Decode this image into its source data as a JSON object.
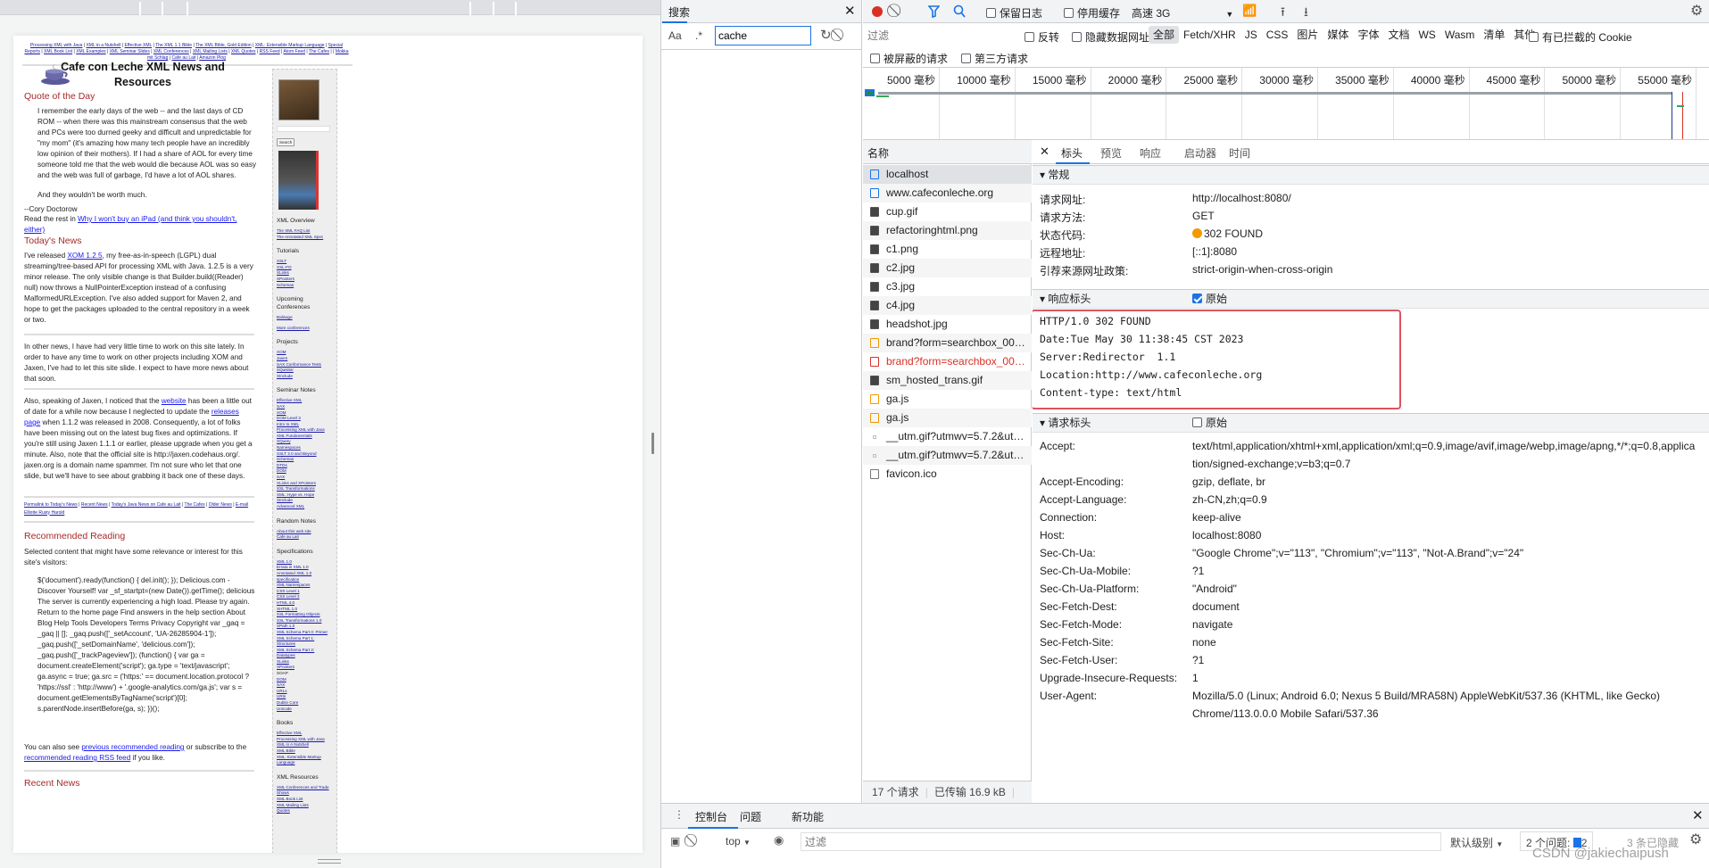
{
  "page": {
    "top_nav": [
      "Processing XML with Java",
      "XML in a Nutshell",
      "Effective XML",
      "The XML 1.1 Bible",
      "The XML Bible, Gold Edition",
      "XML: Extensible Markup Language",
      "Special Reports",
      "XML Book List",
      "XML Examples",
      "XML Seminar Slides",
      "XML Conferences",
      "XML Mailing Lists",
      "XML Quotes",
      "RSS Feed",
      "Atom Feed",
      "The Cafes",
      "",
      "Mokka mit Schlag",
      "Cafe au Lait",
      "Amazon Plog"
    ],
    "title": "Cafe con Leche XML News and Resources",
    "quote_heading": "Quote of the Day",
    "quote": "I remember the early days of the web -- and the last days of CD ROM -- when there was this mainstream consensus that the web and PCs were too durned geeky and difficult and unpredictable for \"my mom\" (it's amazing how many tech people have an incredibly low opinion of their mothers). If I had a share of AOL for every time someone told me that the web would die because AOL was so easy and the web was full of garbage, I'd have a lot of AOL shares.",
    "quote_end": "And they wouldn't be worth much.",
    "quote_author": "--Cory Doctorow",
    "read_rest_prefix": "Read the rest in ",
    "read_rest_link": "Why I won't buy an iPad (and think you shouldn't, either)",
    "news_heading": "Today's News",
    "news1_prefix": "I've released ",
    "news1_link": "XOM 1.2.5",
    "news1_rest": ", my free-as-in-speech (LGPL) dual streaming/tree-based API for processing XML with Java. 1.2.5 is a very minor release. The only visible change is that Builder.build((Reader) null) now throws a NullPointerException instead of a confusing MalformedURLException. I've also added support for Maven 2, and hope to get the packages uploaded to the central repository in a week or two.",
    "news2": "In other news, I have had very little time to work on this site lately. In order to have any time to work on other projects including XOM and Jaxen, I've had to let this site slide. I expect to have more news about that soon.",
    "news3_a": "Also, speaking of Jaxen, I noticed that the ",
    "news3_link1": "website",
    "news3_b": " has been a little out of date for a while now because I neglected to update the ",
    "news3_link2": "releases page",
    "news3_c": " when 1.1.2 was released in 2008. Consequently, a lot of folks have been missing out on the latest bug fixes and optimizations. If you're still using Jaxen 1.1.1 or earlier, please upgrade when you get a minute. Also, note that the official site is http://jaxen.codehaus.org/. jaxen.org is a domain name spammer. I'm not sure who let that one slide, but we'll have to see about grabbing it back one of these days.",
    "news_links": [
      "Permalink to Today's News",
      "Recent News",
      "Today's Java News on Cafe au Lait",
      "The Cafes",
      "Older News",
      "E-mail Elliotte Rusty Harold"
    ],
    "reading_heading": "Recommended Reading",
    "reading_intro": "Selected content that might have some relevance or interest for this site's visitors:",
    "reading_code": "$('document').ready(function() { del.init(); }); Delicious.com - Discover Yourself! var _sf_startpt=(new Date()).getTime(); delicious The server is currently experiencing a high load. Please try again. Return to the home page Find answers in the help section About Blog Help Tools Developers Terms Privacy Copyright var _gaq = _gaq || []; _gaq.push(['_setAccount', 'UA-26285904-1']); _gaq.push(['_setDomainName', 'delicious.com']); _gaq.push(['_trackPageview']); (function() { var ga = document.createElement('script'); ga.type = 'text/javascript'; ga.async = true; ga.src = ('https:' == document.location.protocol ? 'https://ssl' : 'http://www') + '.google-analytics.com/ga.js'; var s = document.getElementsByTagName('script')[0]; s.parentNode.insertBefore(ga, s); })();",
    "reading_more_a": "You can also see ",
    "reading_more_link1": "previous recommended reading",
    "reading_more_b": " or subscribe to the ",
    "reading_more_link2": "recommended reading RSS feed",
    "reading_more_c": " if you like.",
    "recent_heading": "Recent News",
    "search_button": "Search",
    "sidebar": [
      {
        "heading": "XML Overview",
        "links": [
          "The XML FAQ List",
          "The Annotated XML Spec"
        ]
      },
      {
        "heading": "Tutorials",
        "links": [
          "XSLT",
          "XSL-FO",
          "XLinks",
          "XPointers",
          "Schemas"
        ]
      },
      {
        "heading": "Upcoming Conferences",
        "links": [
          "Balisage",
          "More conferences"
        ]
      },
      {
        "heading": "Projects",
        "links": [
          "XOM",
          "Jaxen",
          "SAX Conformance Tests",
          "XQuisitor",
          "XInclude"
        ]
      },
      {
        "heading": "Seminar Notes",
        "links": [
          "Effective XML",
          "SAX",
          "XOM",
          "DOM Level 3",
          "Intro to XML",
          "Processing XML with Java",
          "XML Fundamentals",
          "XQuery",
          "Namespaces",
          "XSLT 2.0 and Beyond",
          "Schemas",
          "DTDs",
          "DOM",
          "SAX",
          "XLinks and XPointers",
          "XSL Transformations",
          "XML: Hype vs. Hope",
          "XInclude",
          "Advanced XML"
        ]
      },
      {
        "heading": "Random Notes",
        "links": [
          "About this web site",
          "Cafe au Lait"
        ]
      },
      {
        "heading": "Specifications",
        "links": [
          "XML 1.0",
          "Errata in XML 1.0",
          "Annotated XML 1.0 specification",
          "XML Namespaces",
          "CSS Level 1",
          "CSS Level 2",
          "HTML 4.0",
          "XHTML 1.0",
          "XSL Formatting Objects",
          "XSL Transformations 1.0",
          "XPath 1.0",
          "XML Schema Part 0: Primer",
          "XML Schema Part 1: Structures",
          "XML Schema Part 2: Datatypes",
          "XLinks",
          "XPointers",
          "SOAP",
          "DOM",
          "SAX",
          "URLs",
          "URIs",
          "Dublin Core",
          "Unicode"
        ]
      },
      {
        "heading": "Books",
        "links": [
          "Effective XML",
          "Processing XML with Java",
          "XML in A Nutshell",
          "XML Bible",
          "XML: Extensible Markup Language"
        ]
      },
      {
        "heading": "XML Resources",
        "links": [
          "XML Conferences and Trade Shows",
          "XML Book List",
          "XML Mailing Lists",
          "Quotes"
        ]
      }
    ]
  },
  "search_panel": {
    "tab": "搜索",
    "case_label": "Aa",
    "regex_label": ".*",
    "query": "cache"
  },
  "network": {
    "preserve_log": "保留日志",
    "disable_cache": "停用缓存",
    "throttle": "高速 3G",
    "filter_placeholder": "过滤",
    "invert": "反转",
    "hide_data_urls": "隐藏数据网址",
    "types": [
      "全部",
      "Fetch/XHR",
      "JS",
      "CSS",
      "图片",
      "媒体",
      "字体",
      "文档",
      "WS",
      "Wasm",
      "清单",
      "其他"
    ],
    "blocked_cookies": "有已拦截的 Cookie",
    "blocked_requests": "被屏蔽的请求",
    "third_party": "第三方请求",
    "ticks": [
      "5000 毫秒",
      "10000 毫秒",
      "15000 毫秒",
      "20000 毫秒",
      "25000 毫秒",
      "30000 毫秒",
      "35000 毫秒",
      "40000 毫秒",
      "45000 毫秒",
      "50000 毫秒",
      "55000 毫秒"
    ],
    "name_header": "名称",
    "requests": [
      {
        "name": "localhost",
        "type": "doc"
      },
      {
        "name": "www.cafeconleche.org",
        "type": "doc"
      },
      {
        "name": "cup.gif",
        "type": "img"
      },
      {
        "name": "refactoringhtml.png",
        "type": "img"
      },
      {
        "name": "c1.png",
        "type": "img"
      },
      {
        "name": "c2.jpg",
        "type": "img"
      },
      {
        "name": "c3.jpg",
        "type": "img"
      },
      {
        "name": "c4.jpg",
        "type": "img"
      },
      {
        "name": "headshot.jpg",
        "type": "img"
      },
      {
        "name": "brand?form=searchbox_00…",
        "type": "script"
      },
      {
        "name": "brand?form=searchbox_00…",
        "type": "error"
      },
      {
        "name": "sm_hosted_trans.gif",
        "type": "img"
      },
      {
        "name": "ga.js",
        "type": "script"
      },
      {
        "name": "ga.js",
        "type": "script"
      },
      {
        "name": "__utm.gif?utmwv=5.7.2&ut…",
        "type": "pixel"
      },
      {
        "name": "__utm.gif?utmwv=5.7.2&ut…",
        "type": "pixel"
      },
      {
        "name": "favicon.ico",
        "type": "other"
      }
    ],
    "status_requests": "17 个请求",
    "status_transferred": "已传输 16.9 kB",
    "detail_tabs": [
      "标头",
      "预览",
      "响应",
      "启动器",
      "时间"
    ],
    "general_heading": "常规",
    "general": [
      {
        "k": "请求网址:",
        "v": "http://localhost:8080/"
      },
      {
        "k": "请求方法:",
        "v": "GET"
      },
      {
        "k": "状态代码:",
        "v": "302 FOUND"
      },
      {
        "k": "远程地址:",
        "v": "[::1]:8080"
      },
      {
        "k": "引荐来源网址政策:",
        "v": "strict-origin-when-cross-origin"
      }
    ],
    "response_heading": "响应标头",
    "raw_label": "原始",
    "response_raw": [
      "HTTP/1.0 302 FOUND",
      "Date:Tue May 30 11:38:45 CST 2023",
      "Server:Redirector  1.1",
      "Location:http://www.cafeconleche.org",
      "Content-type: text/html"
    ],
    "request_heading": "请求标头",
    "request_headers": [
      {
        "k": "Accept:",
        "v": "text/html,application/xhtml+xml,application/xml;q=0.9,image/avif,image/webp,image/apng,*/*;q=0.8,applica",
        "v2": "tion/signed-exchange;v=b3;q=0.7"
      },
      {
        "k": "Accept-Encoding:",
        "v": "gzip, deflate, br"
      },
      {
        "k": "Accept-Language:",
        "v": "zh-CN,zh;q=0.9"
      },
      {
        "k": "Connection:",
        "v": "keep-alive"
      },
      {
        "k": "Host:",
        "v": "localhost:8080"
      },
      {
        "k": "Sec-Ch-Ua:",
        "v": "\"Google Chrome\";v=\"113\", \"Chromium\";v=\"113\", \"Not-A.Brand\";v=\"24\""
      },
      {
        "k": "Sec-Ch-Ua-Mobile:",
        "v": "?1"
      },
      {
        "k": "Sec-Ch-Ua-Platform:",
        "v": "\"Android\""
      },
      {
        "k": "Sec-Fetch-Dest:",
        "v": "document"
      },
      {
        "k": "Sec-Fetch-Mode:",
        "v": "navigate"
      },
      {
        "k": "Sec-Fetch-Site:",
        "v": "none"
      },
      {
        "k": "Sec-Fetch-User:",
        "v": "?1"
      },
      {
        "k": "Upgrade-Insecure-Requests:",
        "v": "1"
      },
      {
        "k": "User-Agent:",
        "v": "Mozilla/5.0 (Linux; Android 6.0; Nexus 5 Build/MRA58N) AppleWebKit/537.36 (KHTML, like Gecko)",
        "v2": "Chrome/113.0.0.0 Mobile Safari/537.36"
      }
    ]
  },
  "drawer": {
    "tabs": [
      "控制台",
      "问题",
      "新功能"
    ],
    "context": "top",
    "filter_placeholder": "过滤",
    "level": "默认级别",
    "issues_label": "2 个问题:",
    "issues_count": "2",
    "hidden": "3 条已隐藏"
  },
  "watermark": "CSDN @jakiechaipush",
  "colors": {
    "accent": "#1a73e8",
    "record": "#d93025",
    "status_302": "#f29900",
    "highlight_box": "#e0515f",
    "heading_red": "#a52a2a"
  }
}
